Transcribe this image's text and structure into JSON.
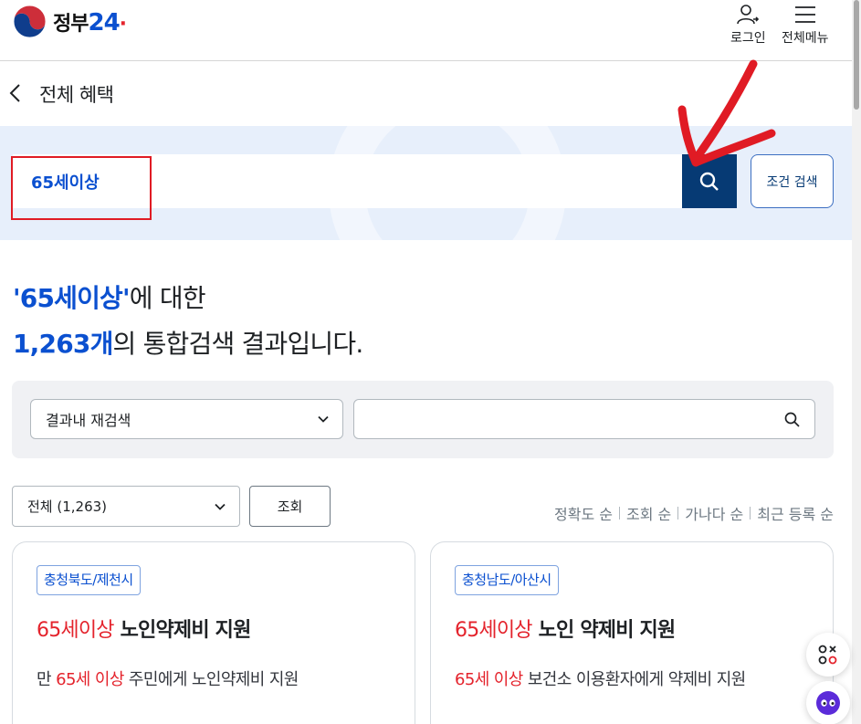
{
  "header": {
    "logo_text": "정부",
    "logo_num": "24",
    "login_label": "로그인",
    "menu_label": "전체메뉴"
  },
  "page": {
    "title": "전체 혜택"
  },
  "search": {
    "value": "65세이상",
    "condition_label": "조건 검색"
  },
  "summary": {
    "keyword": "'65세이상'",
    "suffix1": "에 대한",
    "count": "1,263개",
    "suffix2": "의 통합검색 결과입니다."
  },
  "refine": {
    "select_label": "결과내 재검색",
    "input_value": ""
  },
  "filter": {
    "category_label": "전체 (1,263)",
    "query_label": "조회",
    "sort_options": [
      "정확도 순",
      "조회 순",
      "가나다 순",
      "최근 등록 순"
    ]
  },
  "cards": [
    {
      "region": "충청북도/제천시",
      "title_hl": "65세이상",
      "title_rest": " 노인약제비 지원",
      "desc_pre": "만 ",
      "desc_hl": "65세 이상",
      "desc_post": " 주민에게 노인약제비 지원"
    },
    {
      "region": "충청남도/아산시",
      "title_hl": "65세이상",
      "title_rest": " 노인 약제비 지원",
      "desc_pre": "",
      "desc_hl": "65세 이상",
      "desc_post": " 보건소 이용환자에게 약제비 지원"
    }
  ],
  "colors": {
    "brand_blue": "#0b50d0",
    "navy": "#063a74",
    "highlight_red": "#e4232c",
    "annotation_red": "#e01b24"
  }
}
